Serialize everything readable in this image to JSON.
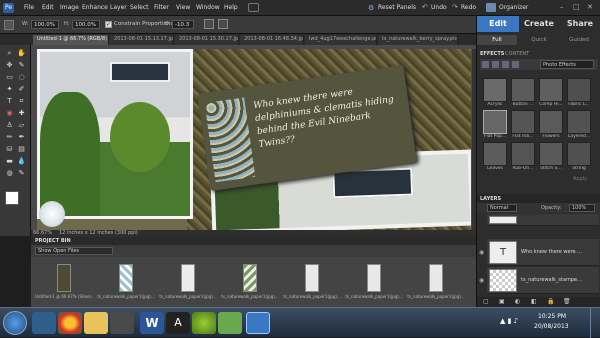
{
  "menubar": {
    "items": [
      "File",
      "Edit",
      "Image",
      "Enhance",
      "Layer",
      "Select",
      "Filter",
      "View",
      "Window",
      "Help"
    ],
    "reset_panels": "Reset Panels",
    "undo": "Undo",
    "redo": "Redo",
    "organizer": "Organizer"
  },
  "options": {
    "width_zoom": "100.0%",
    "height_zoom": "100.0%",
    "constrain": "Constrain Proportions",
    "angle": "-10.3"
  },
  "doc_tabs": [
    "Untitled-1 @ 66.7% (RGB/8) *",
    "2013-08-01 15.13.17.jpg",
    "2013-08-01 15.30.17.jpg",
    "2013-08-01 16.48.34.jpg",
    "lwd_4ug17weechallenge.png",
    "ts_naturewalk_berry_spray.png"
  ],
  "canvas": {
    "journal_text": "Who knew there were delphiniums & clematis hiding behind the Evil Ninebark Twins??"
  },
  "status": {
    "zoom": "66.67%",
    "size": "12 inches x 12 inches (300 ppi)"
  },
  "bin": {
    "title": "PROJECT BIN",
    "show": "Show Open Files",
    "thumbs": [
      "Untitled-1 @ 66.67% (Shoe)...",
      "ts_naturewalk_paper1(jpg)...",
      "ts_naturewalk_paper1(jpg)...",
      "ts_naturewalk_paper1(jpg)...",
      "ts_naturewalk_paper1(jpg)...",
      "ts_naturewalk_paper1(jpg)...",
      "ts_naturewalk_paper1(jpg)..."
    ]
  },
  "panel": {
    "modes": [
      "Edit",
      "Create",
      "Share"
    ],
    "submodes": [
      "Full",
      "Quick",
      "Guided"
    ],
    "effects_tabs": [
      "EFFECTS",
      "CONTENT"
    ],
    "effects_filter": "Photo Effects",
    "effects": [
      "Acrylic",
      "Button ...",
      "Comp Hi...",
      "Fabric L...",
      "Flat Pop...",
      "Flat Rib...",
      "Flowers",
      "Layered...",
      "Leaves",
      "Rub-On...",
      "Stitch S...",
      "String"
    ],
    "apply": "Apply",
    "layers_title": "LAYERS",
    "blend": "Normal",
    "opacity": "Opacity:",
    "opacity_val": "100%",
    "layers": [
      "Who knew there were ...",
      "ts_naturewalk_stampe..."
    ]
  },
  "taskbar": {
    "time": "10:25 PM",
    "date": "20/08/2013"
  },
  "colors": {
    "accent": "#3b78c3",
    "paper_green": "#3f4a2e",
    "tag": "#5a5a44"
  }
}
